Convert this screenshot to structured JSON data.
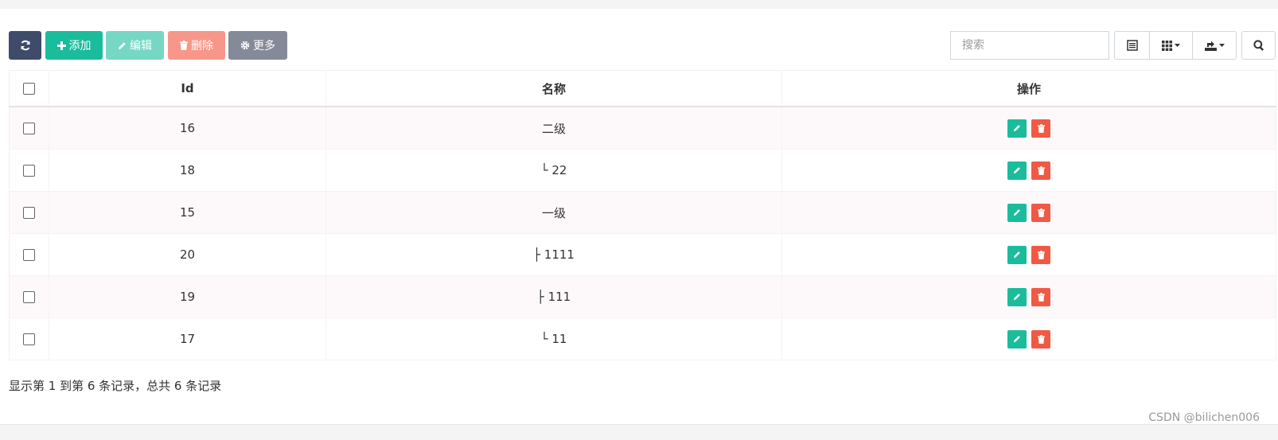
{
  "toolbar": {
    "add_label": "添加",
    "edit_label": "编辑",
    "delete_label": "删除",
    "more_label": "更多",
    "icons": {
      "refresh": "refresh-icon",
      "add": "plus-icon",
      "edit": "pencil-icon",
      "delete": "trash-icon",
      "more": "gear-icon"
    }
  },
  "search": {
    "placeholder": "搜索",
    "value": ""
  },
  "table": {
    "headers": {
      "id": "Id",
      "name": "名称",
      "ops": "操作"
    },
    "rows": [
      {
        "id": "16",
        "name": "二级"
      },
      {
        "id": "18",
        "name": "└ 22"
      },
      {
        "id": "15",
        "name": "一级"
      },
      {
        "id": "20",
        "name": "├ 1111"
      },
      {
        "id": "19",
        "name": "├ 111"
      },
      {
        "id": "17",
        "name": "└ 11"
      }
    ]
  },
  "pagination": {
    "info": "显示第 1 到第 6 条记录，总共 6 条记录"
  },
  "watermark": "CSDN @bilichen006",
  "colors": {
    "refresh": "#3f4b6a",
    "add": "#1abc9c",
    "edit": "#76d8c4",
    "delete": "#f7978a",
    "more": "#858a99",
    "row_edit": "#1abc9c",
    "row_delete": "#f05a45"
  }
}
